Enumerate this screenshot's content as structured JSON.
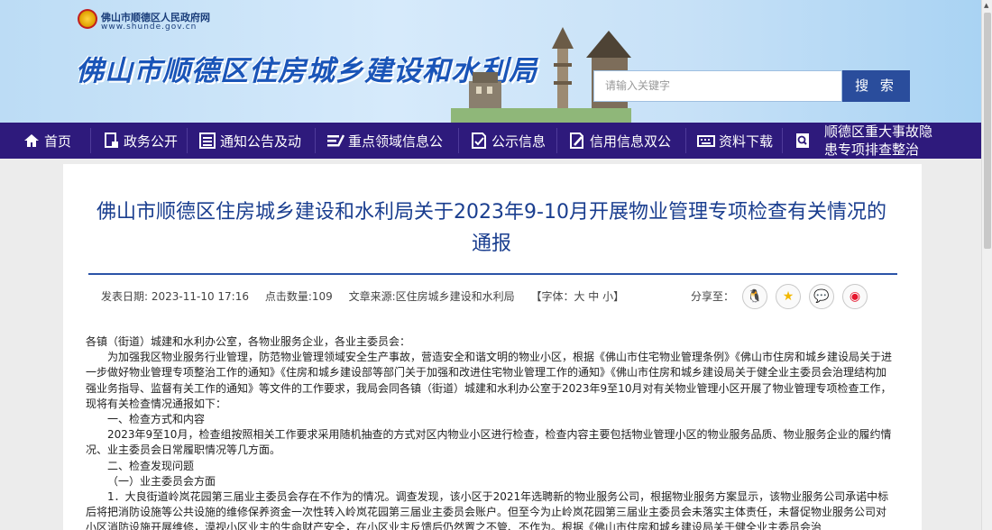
{
  "header": {
    "gov_name": "佛山市顺德区人民政府网",
    "gov_url": "www.shunde.gov.cn",
    "bureau_title": "佛山市顺德区住房城乡建设和水利局",
    "search": {
      "placeholder": "请输入关键字",
      "button": "搜 索"
    }
  },
  "nav": {
    "items": [
      {
        "label": "首页",
        "icon": "home-icon"
      },
      {
        "label": "政务公开",
        "icon": "document-icon"
      },
      {
        "label": "通知公告及动",
        "icon": "list-icon"
      },
      {
        "label": "重点领域信息公",
        "icon": "lines-icon"
      },
      {
        "label": "公示信息",
        "icon": "clipboard-icon"
      },
      {
        "label": "信用信息双公",
        "icon": "pen-doc-icon"
      },
      {
        "label": "资料下载",
        "icon": "keyboard-icon"
      },
      {
        "label": "顺德区重大事故隐",
        "label2": "患专项排查整治",
        "icon": "search-doc-icon"
      }
    ]
  },
  "article": {
    "title": "佛山市顺德区住房城乡建设和水利局关于2023年9-10月开展物业管理专项检查有关情况的通报",
    "meta": {
      "date": "发表日期: 2023-11-10 17:16",
      "clicks": "点击数量:109",
      "source": "文章来源:区住房城乡建设和水利局",
      "font": "【字体：大 中 小】"
    },
    "share_label": "分享至：",
    "paragraphs": [
      "各镇（街道）城建和水利办公室，各物业服务企业，各业主委员会：",
      "为加强我区物业服务行业管理，防范物业管理领域安全生产事故，营造安全和谐文明的物业小区，根据《佛山市住宅物业管理条例》《佛山市住房和城乡建设局关于进一步做好物业管理专项整治工作的通知》《住房和城乡建设部等部门关于加强和改进住宅物业管理工作的通知》《佛山市住房和城乡建设局关于健全业主委员会治理结构加强业务指导、监督有关工作的通知》等文件的工作要求，我局会同各镇（街道）城建和水利办公室于2023年9至10月对有关物业管理小区开展了物业管理专项检查工作，现将有关检查情况通报如下：",
      "一、检查方式和内容",
      "2023年9至10月，检查组按照相关工作要求采用随机抽查的方式对区内物业小区进行检查，检查内容主要包括物业管理小区的物业服务品质、物业服务企业的履约情况、业主委员会日常履职情况等几方面。",
      "二、检查发现问题",
      "（一）业主委员会方面",
      "1．大良街道岭岚花园第三届业主委员会存在不作为的情况。调查发现，该小区于2021年选聘新的物业服务公司，根据物业服务方案显示，该物业服务公司承诺中标后将把消防设施等公共设施的维修保养资金一次性转入岭岚花园第三届业主委员会账户。但至今为止岭岚花园第三届业主委员会未落实主体责任，未督促物业服务公司对小区消防设施开展维修，漠视小区业主的生命财产安全，在小区业主反馈后仍然置之不管、不作为。根据《佛山市住房和城乡建设局关于健全业主委员会治"
    ]
  }
}
